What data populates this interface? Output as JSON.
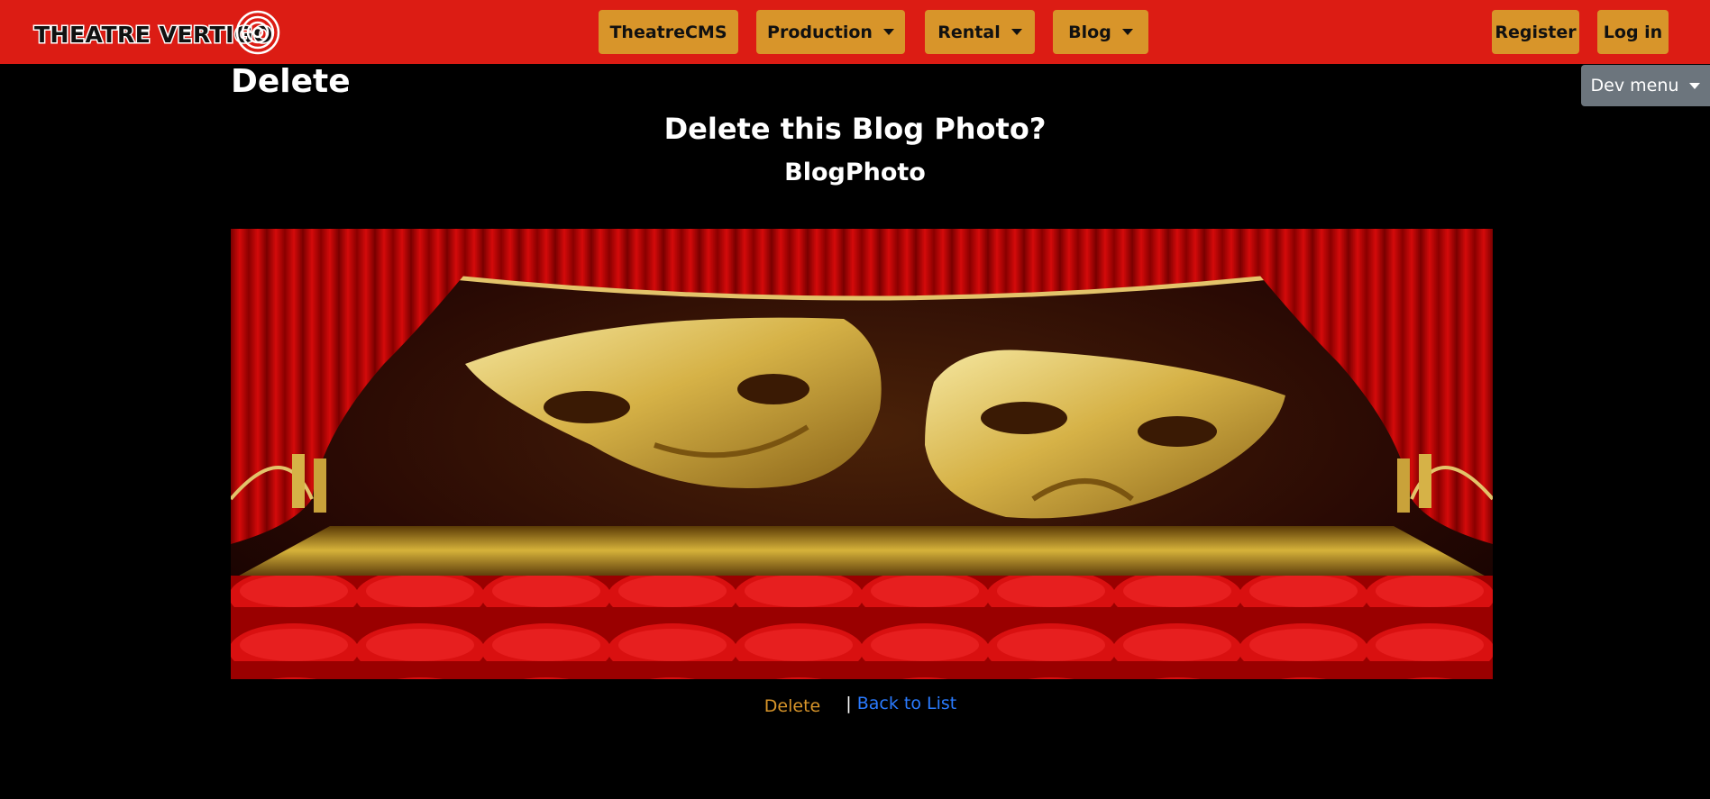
{
  "brand": {
    "name": "THEATRE VERTIGO"
  },
  "nav": {
    "theatrecms": "TheatreCMS",
    "production": "Production",
    "rental": "Rental",
    "blog": "Blog",
    "register": "Register",
    "login": "Log in"
  },
  "dev_menu": {
    "label": "Dev menu"
  },
  "page": {
    "title": "Delete",
    "heading": "Delete this Blog Photo?",
    "photo_label": "BlogPhoto"
  },
  "actions": {
    "delete_label": "Delete",
    "separator": "|",
    "back_label": "Back to List"
  },
  "colors": {
    "navbar": "#dc1c14",
    "nav_button": "#d8952a",
    "dev_menu": "#6c757d",
    "link": "#2a7bff",
    "background": "#000000"
  }
}
